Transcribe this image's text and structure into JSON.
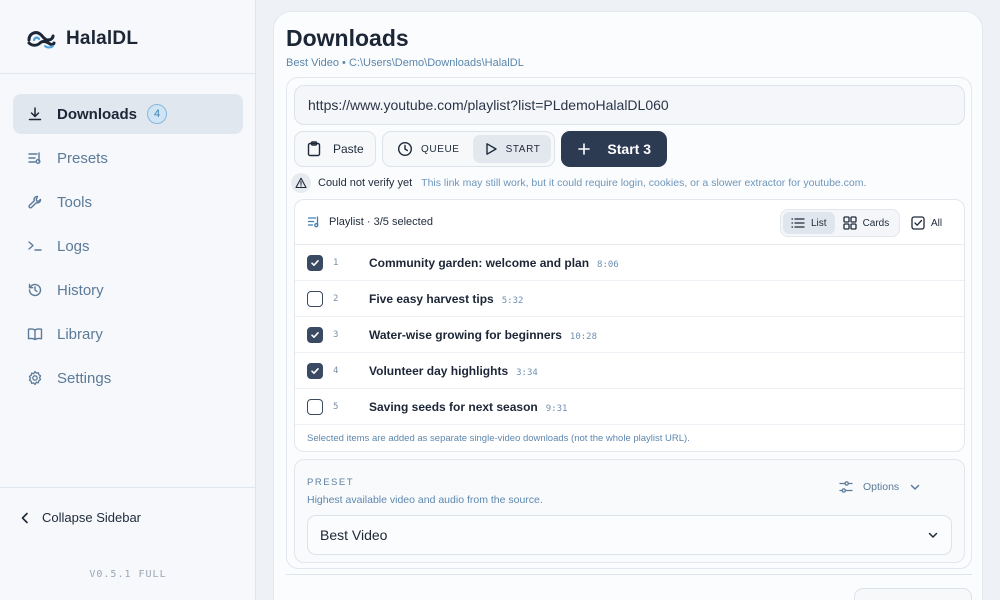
{
  "app": {
    "name": "HalalDL",
    "version": "V0.5.1 FULL"
  },
  "sidebar": {
    "items": [
      {
        "label": "Downloads",
        "icon": "download-icon",
        "badge": "4"
      },
      {
        "label": "Presets",
        "icon": "presets-icon"
      },
      {
        "label": "Tools",
        "icon": "wrench-icon"
      },
      {
        "label": "Logs",
        "icon": "terminal-icon"
      },
      {
        "label": "History",
        "icon": "history-icon"
      },
      {
        "label": "Library",
        "icon": "book-icon"
      },
      {
        "label": "Settings",
        "icon": "gear-icon"
      }
    ],
    "collapse_label": "Collapse Sidebar"
  },
  "main": {
    "title": "Downloads",
    "subtitle": "Best Video • C:\\Users\\Demo\\Downloads\\HalalDL",
    "url_value": "https://www.youtube.com/playlist?list=PLdemoHalalDL060",
    "toolbar": {
      "paste": "Paste",
      "queue": "QUEUE",
      "start": "START",
      "start_n": "Start 3"
    },
    "warning": {
      "title": "Could not verify yet",
      "text": "This link may still work, but it could require login, cookies, or a slower extractor for youtube.com."
    },
    "playlist": {
      "title": "Playlist · 3/5 selected",
      "view_list": "List",
      "view_cards": "Cards",
      "select_all": "All",
      "items": [
        {
          "num": "1",
          "title": "Community garden: welcome and plan",
          "duration": "8:06",
          "checked": true
        },
        {
          "num": "2",
          "title": "Five easy harvest tips",
          "duration": "5:32",
          "checked": false
        },
        {
          "num": "3",
          "title": "Water-wise growing for beginners",
          "duration": "10:28",
          "checked": true
        },
        {
          "num": "4",
          "title": "Volunteer day highlights",
          "duration": "3:34",
          "checked": true
        },
        {
          "num": "5",
          "title": "Saving seeds for next season",
          "duration": "9:31",
          "checked": false
        }
      ],
      "note": "Selected items are added as separate single-video downloads (not the whole playlist URL)."
    },
    "preset": {
      "label": "PRESET",
      "description": "Highest available video and audio from the source.",
      "options": "Options",
      "selected": "Best Video"
    }
  },
  "colors": {
    "accent_dark": "#2c3a52",
    "badge": "#cfe4f4",
    "link_muted": "#5b86ad"
  }
}
